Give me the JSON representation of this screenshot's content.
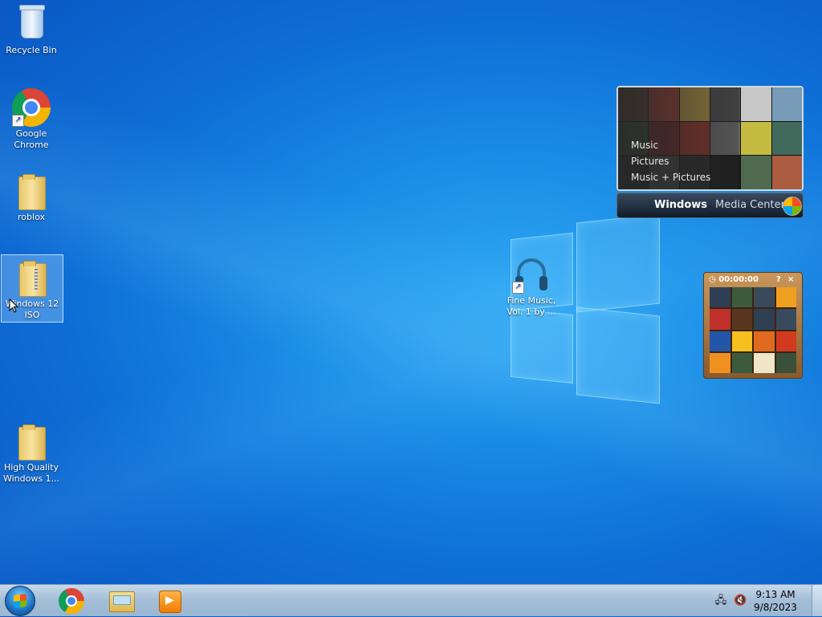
{
  "desktop": {
    "icons": [
      {
        "label": "Recycle Bin"
      },
      {
        "label": "Google Chrome"
      },
      {
        "label": "roblox"
      },
      {
        "label": "Windows 12 ISO"
      },
      {
        "label": "High Quality Windows 1..."
      },
      {
        "label": "Fine Music, Vol. 1 by ..."
      }
    ]
  },
  "media_center_gadget": {
    "menu": [
      "Music",
      "Pictures",
      "Music + Pictures"
    ],
    "brand_bold": "Windows",
    "brand_rest": "Media Center"
  },
  "puzzle_gadget": {
    "timer": "00:00:00",
    "help": "?",
    "close": "×"
  },
  "taskbar": {
    "pinned": [
      {
        "icon": "chrome-icon"
      },
      {
        "icon": "file-explorer-icon"
      },
      {
        "icon": "windows-media-player-icon"
      }
    ],
    "clock": {
      "time": "9:13 AM",
      "date": "9/8/2023"
    },
    "tray": [
      {
        "icon": "network-icon"
      },
      {
        "icon": "volume-muted-icon"
      }
    ]
  }
}
